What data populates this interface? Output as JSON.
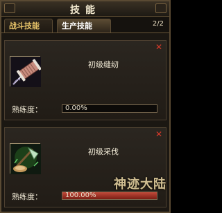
{
  "window": {
    "title": "技能"
  },
  "tabs": [
    {
      "label": "战斗技能",
      "active": false
    },
    {
      "label": "生产技能",
      "active": true
    }
  ],
  "page_count": "2/2",
  "skills": [
    {
      "name": "初级缝纫",
      "proficiency_label": "熟练度：",
      "progress": 0.0,
      "progress_text": "0.00%",
      "icon": "sewing-thread-icon"
    },
    {
      "name": "初级采伐",
      "proficiency_label": "熟练度：",
      "progress": 1.0,
      "progress_text": "100.00%",
      "icon": "axe-icon"
    }
  ],
  "watermark": "神迹大陆",
  "colors": {
    "progress_fill": "#c24a3a",
    "close": "#d83a2a"
  }
}
